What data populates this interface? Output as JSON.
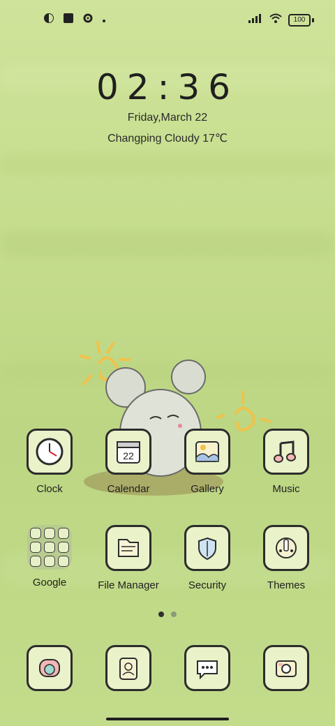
{
  "status_bar": {
    "battery": "100",
    "icons": [
      "moon-icon",
      "square-icon",
      "gear-icon",
      "dot-icon",
      "signal-icon",
      "wifi-icon",
      "battery-icon"
    ]
  },
  "lockscreen": {
    "time": "02:36",
    "date": "Friday,March 22",
    "weather": "Changping Cloudy 17℃"
  },
  "apps_row1": [
    {
      "label": "Clock",
      "icon": "clock-icon"
    },
    {
      "label": "Calendar",
      "icon": "calendar-icon",
      "day": "22"
    },
    {
      "label": "Gallery",
      "icon": "gallery-icon"
    },
    {
      "label": "Music",
      "icon": "music-icon"
    }
  ],
  "apps_row2": [
    {
      "label": "Google",
      "icon": "folder-icon"
    },
    {
      "label": "File Manager",
      "icon": "file-manager-icon"
    },
    {
      "label": "Security",
      "icon": "shield-icon"
    },
    {
      "label": "Themes",
      "icon": "themes-icon"
    }
  ],
  "page_indicator": {
    "pages": 2,
    "current": 1
  },
  "dock": [
    {
      "icon": "phone-icon"
    },
    {
      "icon": "contacts-icon"
    },
    {
      "icon": "messages-icon"
    },
    {
      "icon": "camera-icon"
    }
  ],
  "colors": {
    "background": "#c4dc8c",
    "icon_fill": "#e9f2c9",
    "stroke": "#2c2c2c"
  }
}
